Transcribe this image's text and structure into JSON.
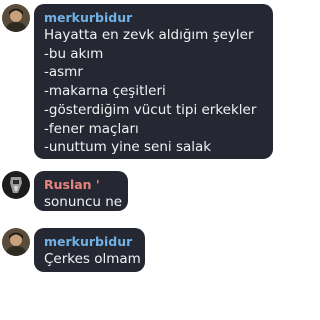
{
  "messages": [
    {
      "sender": "merkurbidur",
      "sender_color": "#6fb3e6",
      "avatar": "avatar-photo",
      "lines": [
        "Hayatta en zevk aldığım şeyler",
        "-bu akım",
        "-asmr",
        "-makarna çeşitleri",
        "-gösterdiğim vücut tipi erkekler",
        "-fener maçları",
        "-unuttum yine seni salak"
      ]
    },
    {
      "sender": "Ruslan '",
      "sender_color": "#e8847c",
      "avatar": "avatar-photo",
      "lines": [
        "sonuncu ne"
      ]
    },
    {
      "sender": "merkurbidur",
      "sender_color": "#6fb3e6",
      "avatar": "avatar-photo",
      "lines": [
        "Çerkes olmam"
      ]
    }
  ],
  "colors": {
    "bubble_background": "#252832",
    "message_text": "#f1f2f4",
    "page_background": "#ffffff"
  }
}
